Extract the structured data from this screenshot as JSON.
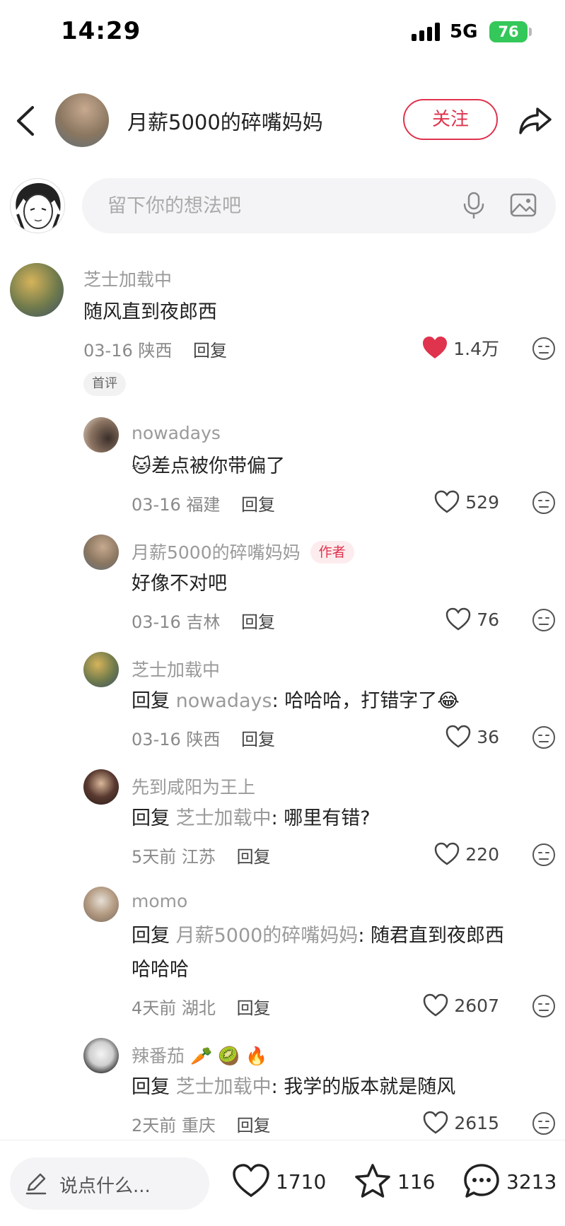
{
  "status_bar": {
    "time": "14:29",
    "network": "5G",
    "battery": "76"
  },
  "header": {
    "title": "月薪5000的碎嘴妈妈",
    "follow_label": "关注"
  },
  "comment_input": {
    "placeholder": "留下你的想法吧"
  },
  "comments": [
    {
      "name": "芝士加载中",
      "text": "随风直到夜郎西",
      "date": "03-16",
      "location": "陕西",
      "reply_label": "回复",
      "likes": "1.4万",
      "liked": true,
      "tag": "首评"
    },
    {
      "name": "nowadays",
      "emoji": "🐱",
      "text": "差点被你带偏了",
      "date": "03-16",
      "location": "福建",
      "reply_label": "回复",
      "likes": "529"
    },
    {
      "name": "月薪5000的碎嘴妈妈",
      "author_tag": "作者",
      "text": "好像不对吧",
      "date": "03-16",
      "location": "吉林",
      "reply_label": "回复",
      "likes": "76"
    },
    {
      "name": "芝士加载中",
      "reply_prefix": "回复",
      "reply_to": "nowadays",
      "text": ": 哈哈哈，打错字了",
      "emoji_after": "😂",
      "date": "03-16",
      "location": "陕西",
      "reply_label": "回复",
      "likes": "36"
    },
    {
      "name": "先到咸阳为王上",
      "reply_prefix": "回复",
      "reply_to": "芝士加载中",
      "text": ": 哪里有错?",
      "date": "5天前",
      "location": "江苏",
      "reply_label": "回复",
      "likes": "220"
    },
    {
      "name": "momo",
      "reply_prefix": "回复",
      "reply_to": "月薪5000的碎嘴妈妈",
      "text": ": 随君直到夜郎西",
      "text_line2": "哈哈哈",
      "date": "4天前",
      "location": "湖北",
      "reply_label": "回复",
      "likes": "2607"
    },
    {
      "name": "辣番茄",
      "name_emoji": "🥕 🥝 🔥",
      "reply_prefix": "回复",
      "reply_to": "芝士加载中",
      "text": ": 我学的版本就是随风",
      "date": "2天前",
      "location": "重庆",
      "reply_label": "回复",
      "likes": "2615"
    }
  ],
  "bottom_bar": {
    "input_label": "说点什么...",
    "likes": "1710",
    "favorites": "116",
    "comments": "3213"
  },
  "colors": {
    "accent": "#e0334d",
    "battery": "#34c759"
  }
}
